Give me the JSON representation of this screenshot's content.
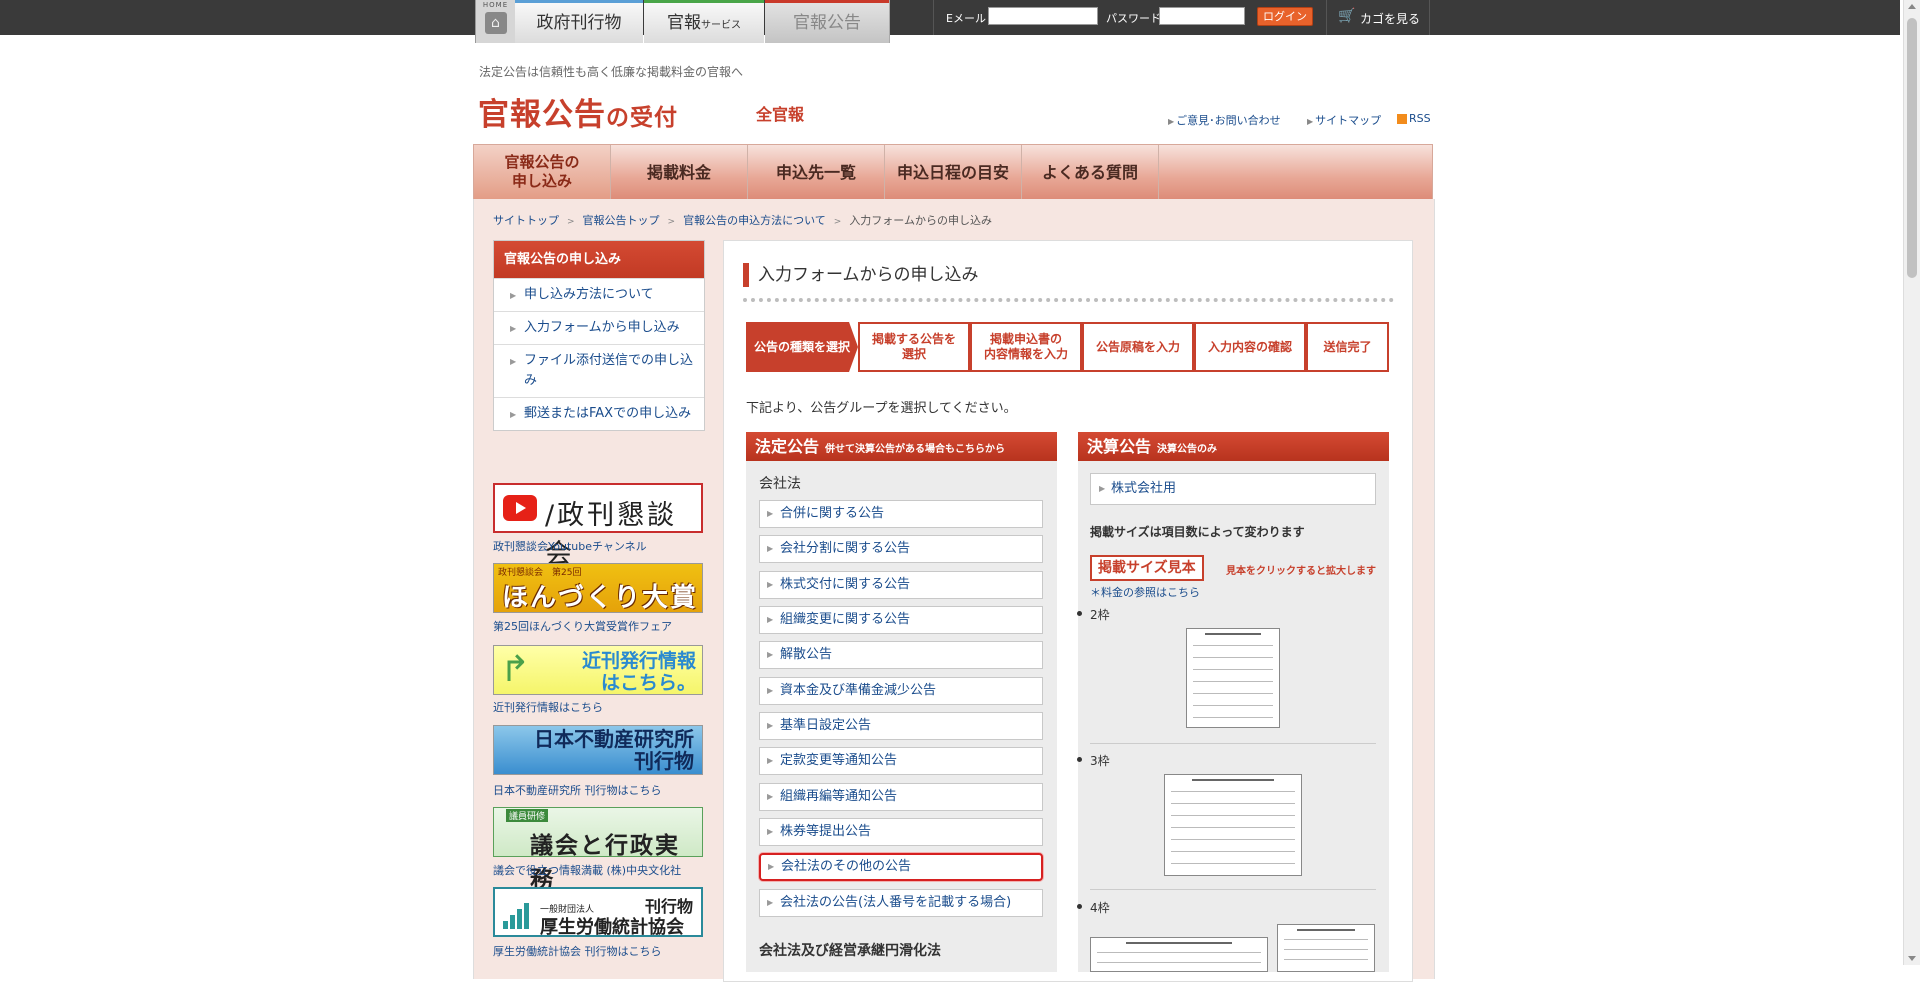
{
  "topbar": {
    "home_label": "HOME",
    "tabs": [
      "政府刊行物",
      "官報",
      "サービス",
      "官報公告"
    ],
    "email_label": "Eメール",
    "email_value": "",
    "password_label": "パスワード",
    "password_value": "",
    "login_label": "ログイン",
    "cart_label": "カゴを見る",
    "icons": {
      "home": "home-icon",
      "cart": "cart-icon"
    }
  },
  "header": {
    "tagline": "法定公告は信頼性も高く低廉な掲載料金の官報へ",
    "logo_main": "官報公告",
    "logo_sub": "の受付",
    "brand": "全官報",
    "links": [
      "ご意見･お問い合わせ",
      "サイトマップ",
      "RSS"
    ]
  },
  "nav": {
    "items": [
      "官報公告の\n申し込み",
      "掲載料金",
      "申込先一覧",
      "申込日程の目安",
      "よくある質問"
    ]
  },
  "breadcrumb": [
    "サイトトップ",
    "官報公告トップ",
    "官報公告の申込方法について",
    "入力フォームからの申し込み"
  ],
  "sidebar": {
    "title": "官報公告の申し込み",
    "items": [
      "申し込み方法について",
      "入力フォームから申し込み",
      "ファイル添付送信での申し込み",
      "郵送またはFAXでの申し込み"
    ],
    "banners": [
      {
        "text": "/政刊懇談会",
        "caption": "政刊懇談会Youtubeチャンネル"
      },
      {
        "small": "政刊懇談会　第25回",
        "text": "ほんづくり大賞",
        "caption": "第25回ほんづくり大賞受賞作フェア"
      },
      {
        "text": "近刊発行情報\nはこちら。",
        "caption": "近刊発行情報はこちら"
      },
      {
        "text": "日本不動産研究所\n刊行物",
        "caption": "日本不動産研究所 刊行物はこちら"
      },
      {
        "small": "議員研修",
        "text": "議会と行政実務",
        "caption": "議会で役立つ情報満載 (株)中央文化社"
      },
      {
        "small": "一般財団法人",
        "text": "厚生労働統計協会",
        "tag": "刊行物",
        "caption": "厚生労働統計協会 刊行物はこちら"
      }
    ]
  },
  "main": {
    "title": "入力フォームからの申し込み",
    "steps": [
      "公告の種類を選択",
      "掲載する公告を\n選択",
      "掲載申込書の\n内容情報を入力",
      "公告原稿を入力",
      "入力内容の確認",
      "送信完了"
    ],
    "lead": "下記より、公告グループを選択してください。",
    "left": {
      "heading": "法定公告",
      "heading_sub": "併せて決算公告がある場合もこちらから",
      "group1": "会社法",
      "buttons": [
        "合併に関する公告",
        "会社分割に関する公告",
        "株式交付に関する公告",
        "組織変更に関する公告",
        "解散公告",
        "資本金及び準備金減少公告",
        "基準日設定公告",
        "定款変更等通知公告",
        "組織再編等通知公告",
        "株券等提出公告",
        "会社法のその他の公告",
        "会社法の公告(法人番号を記載する場合)"
      ],
      "group2": "会社法及び経営承継円滑化法"
    },
    "right": {
      "heading": "決算公告",
      "heading_sub": "決算公告のみ",
      "button": "株式会社用",
      "size_note": "掲載サイズは項目数によって変わります",
      "size_sample": "掲載サイズ見本",
      "size_click": "見本をクリックすると拡大します",
      "fee_link": "＊料金の参照はこちら",
      "frames": [
        "2枠",
        "3枠",
        "4枠"
      ]
    }
  }
}
